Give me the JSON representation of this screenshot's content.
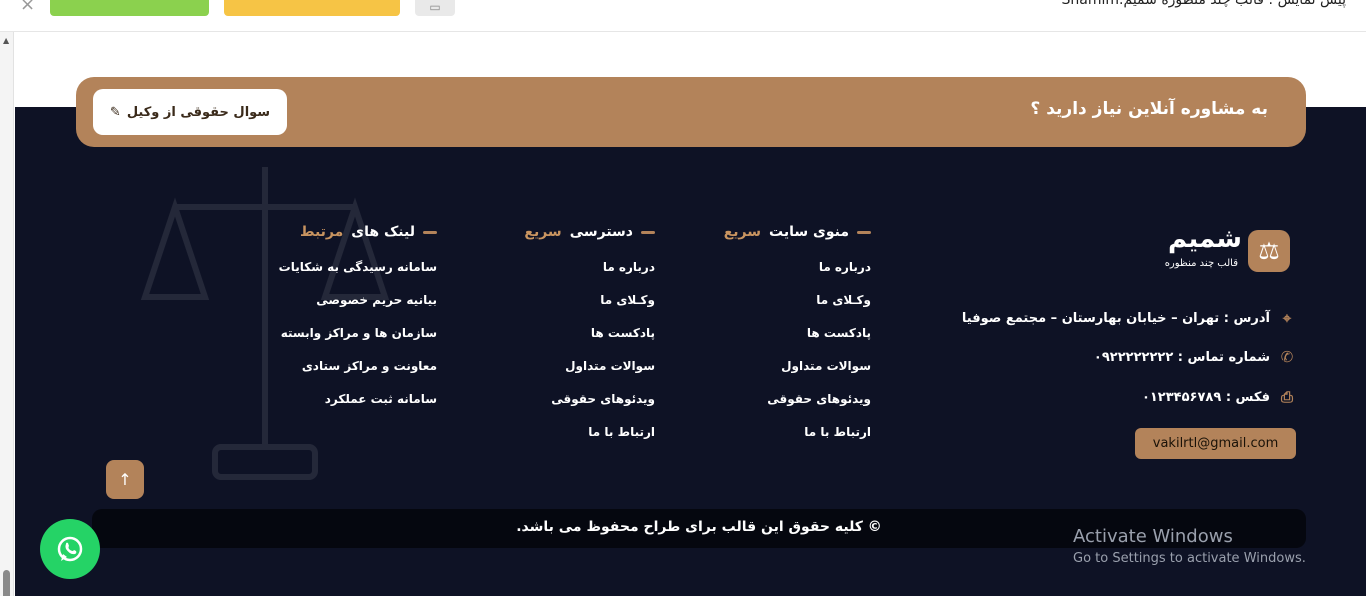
{
  "topbar": {
    "close_glyph": "×",
    "preview_title": "پیش نمایش : قالب چند منظوره شمیم.Shamim",
    "gray_button_icon": "monitor-icon"
  },
  "consultation": {
    "title": "به مشاوره آنلاین نیاز دارید ؟",
    "button_label": "سوال حقوقی از وکیل",
    "button_icon": "pencil-icon"
  },
  "brand": {
    "name": "شمیم",
    "subtitle": "قالب چند منظوره",
    "logo_icon": "scales-icon"
  },
  "contact": {
    "address": "آدرس : تهران – خیابان بهارستان – مجتمع صوفیا",
    "phone": "شماره تماس : ۰۹۲۲۲۲۲۲۲۲",
    "fax": "فکس : ۰۱۲۳۴۵۶۷۸۹",
    "email": "vakilrtl@gmail.com"
  },
  "columns": [
    {
      "title_prefix": "منوی سایت",
      "title_accent": "سریع",
      "items": [
        "درباره ما",
        "وکـلای ما",
        "پادکست ها",
        "سوالات متداول",
        "ویدئوهای حقوقی",
        "ارتباط با ما"
      ]
    },
    {
      "title_prefix": "دسترسی",
      "title_accent": "سریع",
      "items": [
        "درباره ما",
        "وکـلای ما",
        "پادکست ها",
        "سوالات متداول",
        "ویدئوهای حقوقی",
        "ارتباط با ما"
      ]
    },
    {
      "title_prefix": "لینک های",
      "title_accent": "مرتبط",
      "items": [
        "سامانه رسیدگی به شکایات",
        "بیانیه حریم خصوصی",
        "سازمان ها و مراکز وابسته",
        "معاونت و مراکز ستادی",
        "سامانه ثبت عملکرد"
      ]
    }
  ],
  "copyright": "© کلیه حقوق این قالب برای طراح محفوظ می باشد.",
  "windows": {
    "line1": "Activate Windows",
    "line2": "Go to Settings to activate Windows."
  },
  "colors": {
    "accent": "#b3835a",
    "footer_bg": "#0e1225",
    "whatsapp": "#25d366"
  }
}
